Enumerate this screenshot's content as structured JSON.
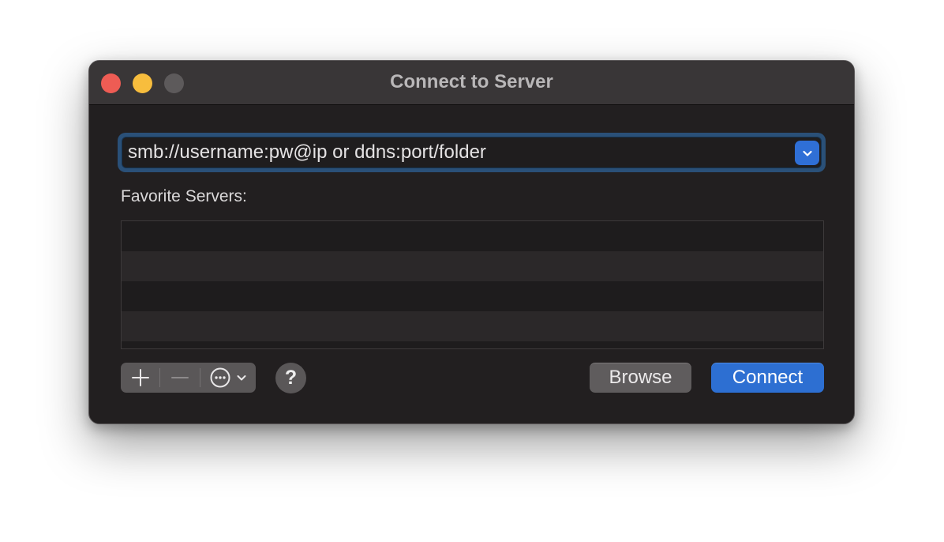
{
  "window": {
    "title": "Connect to Server"
  },
  "address": {
    "placeholder": "smb://username:pw@ip or ddns:port/folder",
    "dropdown_icon": "chevron-down-icon"
  },
  "favorites": {
    "label": "Favorite Servers:",
    "items": []
  },
  "toolbar": {
    "add_icon": "plus-icon",
    "remove_icon": "minus-icon",
    "more_icon": "ellipsis-circle-icon",
    "help_label": "?"
  },
  "buttons": {
    "browse_label": "Browse",
    "connect_label": "Connect"
  },
  "colors": {
    "accent": "#2d6fd2",
    "close": "#ee5c54",
    "minimize": "#f7bd3d",
    "zoom_disabled": "#5d5a5b"
  }
}
